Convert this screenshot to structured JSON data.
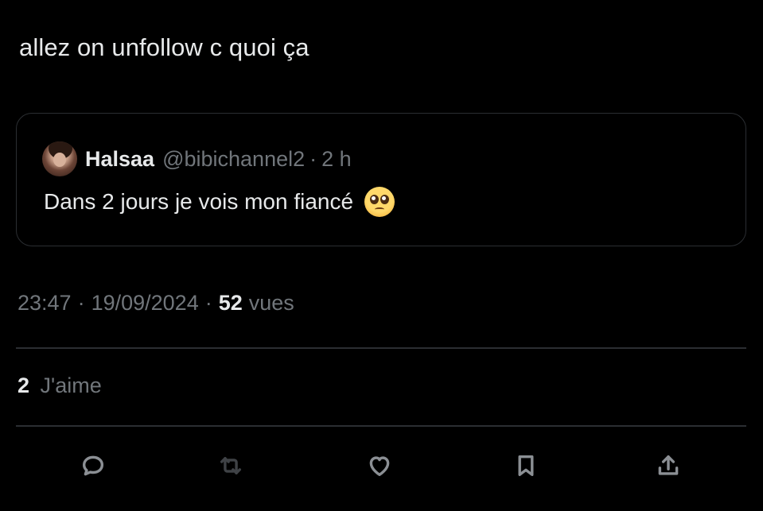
{
  "tweet": {
    "text": "allez on unfollow c quoi ça"
  },
  "quote": {
    "name": "Halsaa",
    "handle": "@bibichannel2",
    "separator": "·",
    "time": "2 h",
    "text": "Dans 2 jours je vois mon fiancé",
    "emoji": "pleading-face-emoji"
  },
  "meta": {
    "time": "23:47",
    "separator": "·",
    "date": "19/09/2024",
    "separator2": "·",
    "views_count": "52",
    "views_label": "vues"
  },
  "likes": {
    "count": "2",
    "label": "J'aime"
  },
  "actions": {
    "icons": [
      "reply-icon",
      "retweet-icon",
      "like-icon",
      "bookmark-icon",
      "share-icon"
    ],
    "icon_color": "#8b8f94"
  },
  "colors": {
    "background": "#000000",
    "text": "#e7e9ea",
    "secondary": "#71767b",
    "border": "#2b2e32"
  }
}
